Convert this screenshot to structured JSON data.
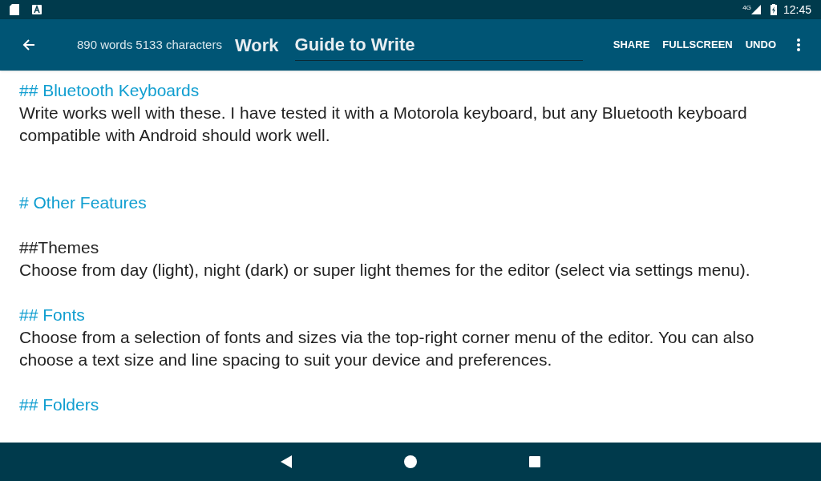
{
  "status_bar": {
    "network": "4G",
    "time": "12:45"
  },
  "app_bar": {
    "stats": "890 words 5133 characters",
    "folder": "Work",
    "title": "Guide to Write",
    "actions": [
      "SHARE",
      "FULLSCREEN",
      "UNDO"
    ]
  },
  "editor": [
    {
      "kind": "heading",
      "text": "## Bluetooth Keyboards"
    },
    {
      "kind": "text",
      "text": "Write works well with these. I have tested it with a Motorola keyboard, but any Bluetooth keyboard compatible with Android should work well."
    },
    {
      "kind": "blank"
    },
    {
      "kind": "blank"
    },
    {
      "kind": "heading",
      "text": "# Other Features"
    },
    {
      "kind": "blank"
    },
    {
      "kind": "text",
      "text": "##Themes"
    },
    {
      "kind": "text",
      "text": "Choose from day (light), night (dark) or super light themes for the editor (select via settings menu)."
    },
    {
      "kind": "blank"
    },
    {
      "kind": "heading",
      "text": "## Fonts"
    },
    {
      "kind": "text",
      "text": "Choose from a selection of fonts and sizes via the top-right corner menu of the editor. You can also choose a text size and line spacing to suit your device and preferences."
    },
    {
      "kind": "blank"
    },
    {
      "kind": "heading",
      "text": "## Folders"
    }
  ]
}
